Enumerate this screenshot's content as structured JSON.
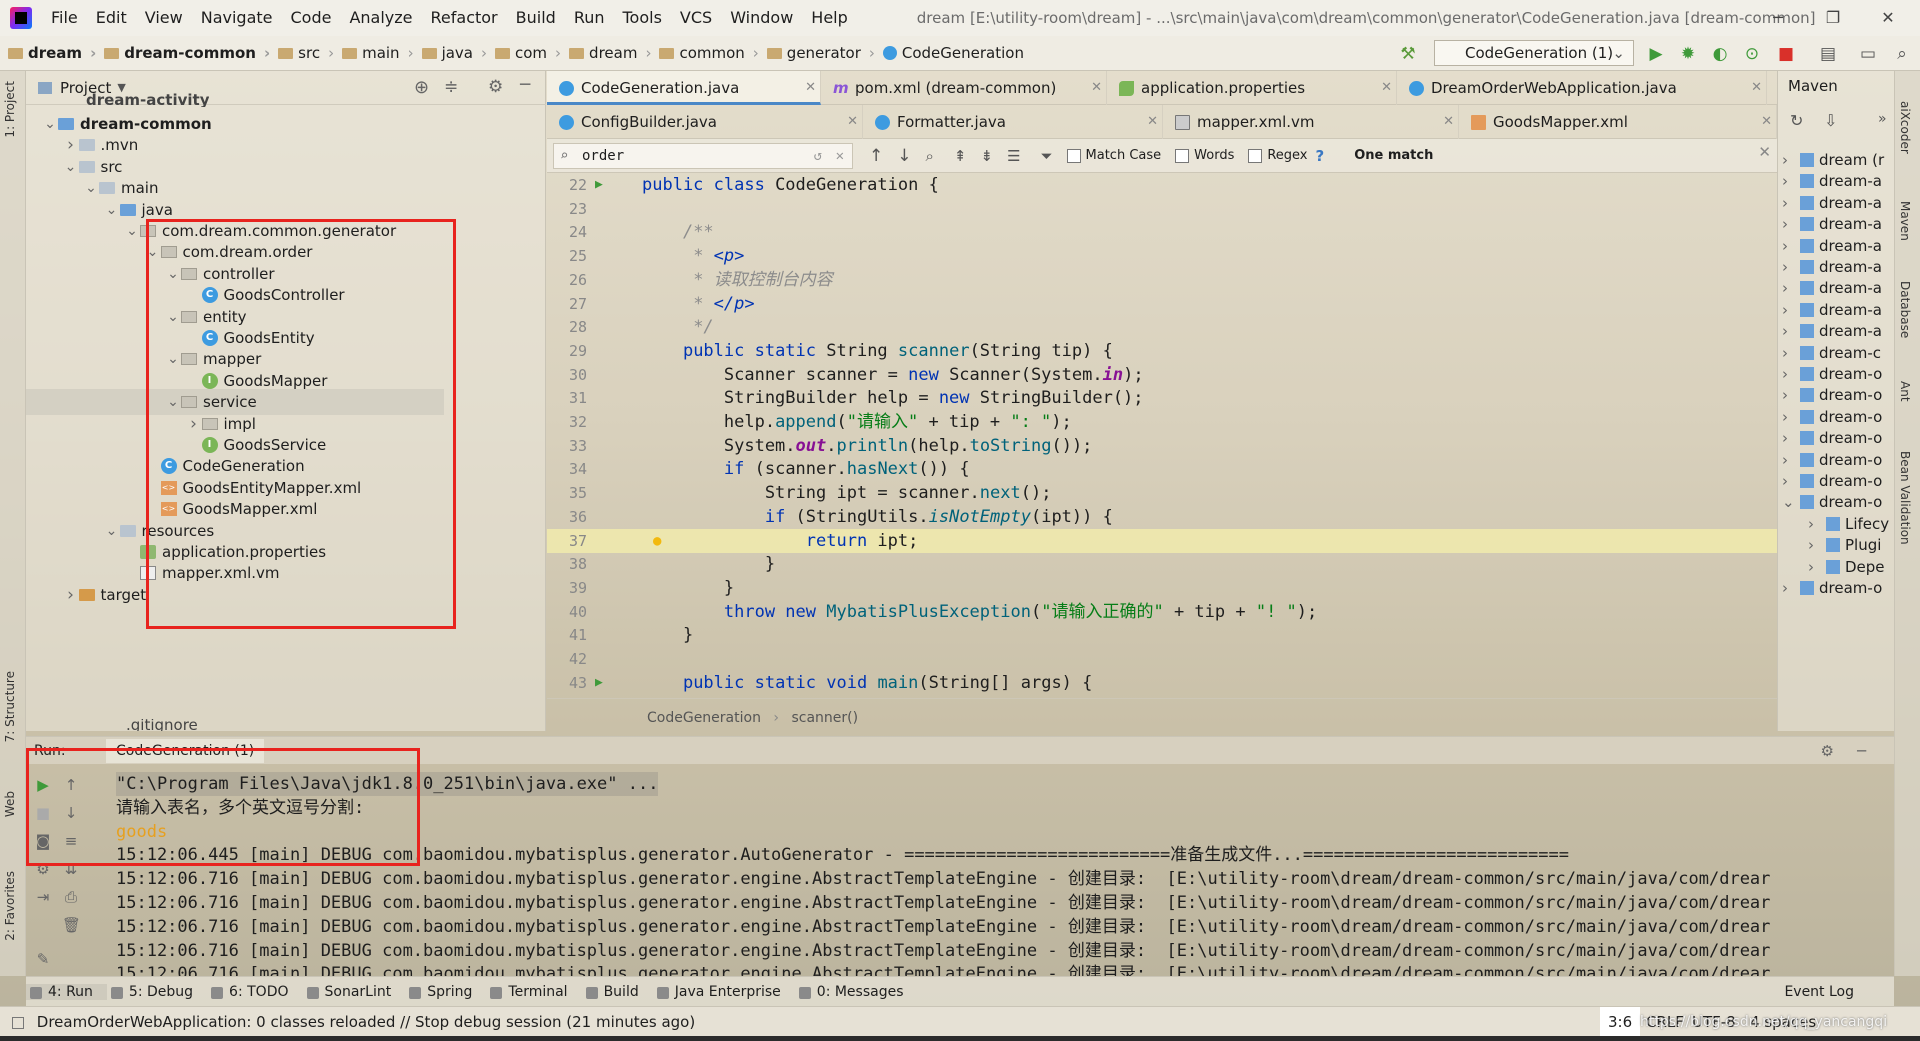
{
  "menu": {
    "items": [
      "File",
      "Edit",
      "View",
      "Navigate",
      "Code",
      "Analyze",
      "Refactor",
      "Build",
      "Run",
      "Tools",
      "VCS",
      "Window",
      "Help"
    ],
    "title": "dream [E:\\utility-room\\dream] - ...\\src\\main\\java\\com\\dream\\common\\generator\\CodeGeneration.java [dream-common]"
  },
  "breadcrumbs": [
    "dream",
    "dream-common",
    "src",
    "main",
    "java",
    "com",
    "dream",
    "common",
    "generator",
    "CodeGeneration"
  ],
  "run_config": "CodeGeneration (1)",
  "project": {
    "header": "Project",
    "truncated_top": "dream-activity",
    "rows": [
      {
        "label": "dream-common",
        "indent": 0,
        "icon": "module",
        "arrow": "down",
        "bold": true
      },
      {
        "label": ".mvn",
        "indent": 1,
        "icon": "folder",
        "arrow": "right"
      },
      {
        "label": "src",
        "indent": 1,
        "icon": "folder",
        "arrow": "down"
      },
      {
        "label": "main",
        "indent": 2,
        "icon": "folder",
        "arrow": "down"
      },
      {
        "label": "java",
        "indent": 3,
        "icon": "folder-blue",
        "arrow": "down"
      },
      {
        "label": "com.dream.common.generator",
        "indent": 4,
        "icon": "package",
        "arrow": "down"
      },
      {
        "label": "com.dream.order",
        "indent": 5,
        "icon": "package",
        "arrow": "down"
      },
      {
        "label": "controller",
        "indent": 6,
        "icon": "package",
        "arrow": "down"
      },
      {
        "label": "GoodsController",
        "indent": 7,
        "icon": "class",
        "arrow": ""
      },
      {
        "label": "entity",
        "indent": 6,
        "icon": "package",
        "arrow": "down"
      },
      {
        "label": "GoodsEntity",
        "indent": 7,
        "icon": "class",
        "arrow": ""
      },
      {
        "label": "mapper",
        "indent": 6,
        "icon": "package",
        "arrow": "down"
      },
      {
        "label": "GoodsMapper",
        "indent": 7,
        "icon": "interface",
        "arrow": ""
      },
      {
        "label": "service",
        "indent": 6,
        "icon": "package",
        "arrow": "down"
      },
      {
        "label": "impl",
        "indent": 7,
        "icon": "package",
        "arrow": "right"
      },
      {
        "label": "GoodsService",
        "indent": 7,
        "icon": "interface",
        "arrow": ""
      },
      {
        "label": "CodeGeneration",
        "indent": 5,
        "icon": "class",
        "arrow": ""
      },
      {
        "label": "GoodsEntityMapper.xml",
        "indent": 5,
        "icon": "xml",
        "arrow": ""
      },
      {
        "label": "GoodsMapper.xml",
        "indent": 5,
        "icon": "xml",
        "arrow": ""
      },
      {
        "label": "resources",
        "indent": 3,
        "icon": "folder",
        "arrow": "down"
      },
      {
        "label": "application.properties",
        "indent": 4,
        "icon": "props",
        "arrow": ""
      },
      {
        "label": "mapper.xml.vm",
        "indent": 4,
        "icon": "vm",
        "arrow": ""
      },
      {
        "label": "target",
        "indent": 1,
        "icon": "folder-orange",
        "arrow": "right"
      }
    ],
    "truncated_bottom": ".gitignore"
  },
  "tabs_row1": [
    {
      "label": "CodeGeneration.java",
      "icon": "class",
      "active": true
    },
    {
      "label": "pom.xml (dream-common)",
      "icon": "m"
    },
    {
      "label": "application.properties",
      "icon": "leaf"
    },
    {
      "label": "DreamOrderWebApplication.java",
      "icon": "class"
    }
  ],
  "tabs_row2": [
    {
      "label": "ConfigBuilder.java",
      "icon": "class"
    },
    {
      "label": "Formatter.java",
      "icon": "class"
    },
    {
      "label": "mapper.xml.vm",
      "icon": "vm"
    },
    {
      "label": "GoodsMapper.xml",
      "icon": "xml"
    }
  ],
  "find": {
    "query": "order",
    "match_case": "Match Case",
    "words": "Words",
    "regex": "Regex",
    "help": "?",
    "result": "One match"
  },
  "code_lines": [
    {
      "n": "22",
      "html": "<span class='kw'>public class</span> CodeGeneration {"
    },
    {
      "n": "23",
      "html": ""
    },
    {
      "n": "24",
      "html": "    <span class='cm'>/**</span>"
    },
    {
      "n": "25",
      "html": "     <span class='cm'>* </span><span class='tag'>&lt;p&gt;</span>"
    },
    {
      "n": "26",
      "html": "     <span class='cm'>* 读取控制台内容</span>"
    },
    {
      "n": "27",
      "html": "     <span class='cm'>* </span><span class='tag'>&lt;/p&gt;</span>"
    },
    {
      "n": "28",
      "html": "     <span class='cm'>*/</span>"
    },
    {
      "n": "29",
      "html": "    <span class='kw'>public static</span> String <span class='fn'>scanner</span>(String tip) {"
    },
    {
      "n": "30",
      "html": "        Scanner scanner = <span class='kw'>new</span> Scanner(System.<span class='fld'>in</span>);"
    },
    {
      "n": "31",
      "html": "        StringBuilder help = <span class='kw'>new</span> StringBuilder();"
    },
    {
      "n": "32",
      "html": "        help.<span class='fn'>append</span>(<span class='str'>\"请输入\"</span> + tip + <span class='str'>\": \"</span>);"
    },
    {
      "n": "33",
      "html": "        System.<span class='fld'>out</span>.<span class='fn'>println</span>(help.<span class='fn'>toString</span>());"
    },
    {
      "n": "34",
      "html": "        <span class='kw'>if</span> (scanner.<span class='fn'>hasNext</span>()) {"
    },
    {
      "n": "35",
      "html": "            String ipt = scanner.<span class='fn'>next</span>();"
    },
    {
      "n": "36",
      "html": "            <span class='kw'>if</span> (StringUtils.<span class='fn' style='font-style:italic'>isNotEmpty</span>(ipt)) {"
    },
    {
      "n": "37",
      "html": "                <span class='kw'>return</span> ipt;",
      "hl": true
    },
    {
      "n": "38",
      "html": "            }"
    },
    {
      "n": "39",
      "html": "        }"
    },
    {
      "n": "40",
      "html": "        <span class='kw'>throw new</span> <span class='fn'>MybatisPlusException</span>(<span class='str'>\"请输入正确的\"</span> + tip + <span class='str'>\"! \"</span>);"
    },
    {
      "n": "41",
      "html": "    }"
    },
    {
      "n": "42",
      "html": ""
    },
    {
      "n": "43",
      "html": "    <span class='kw'>public static void</span> <span class='fn'>main</span>(String[] args) {"
    }
  ],
  "editor_breadcrumb": [
    "CodeGeneration",
    "scanner()"
  ],
  "maven": {
    "title": "Maven",
    "rows": [
      "dream (r",
      "dream-a",
      "dream-a",
      "dream-a",
      "dream-a",
      "dream-a",
      "dream-a",
      "dream-a",
      "dream-a",
      "dream-c",
      "dream-o",
      "dream-o",
      "dream-o",
      "dream-o",
      "dream-o",
      "dream-o",
      "dream-o",
      "Lifecy",
      "Plugi",
      "Depe",
      "dream-o"
    ]
  },
  "run": {
    "label": "Run:",
    "config": "CodeGeneration (1)",
    "lines": [
      {
        "text": "\"C:\\Program Files\\Java\\jdk1.8.0_251\\bin\\java.exe\" ...",
        "kind": "cmd"
      },
      {
        "text": "请输入表名，多个英文逗号分割:",
        "kind": "out"
      },
      {
        "text": "goods",
        "kind": "input"
      },
      {
        "text": "15:12:06.445 [main] DEBUG com.baomidou.mybatisplus.generator.AutoGenerator - ==========================准备生成文件...==========================",
        "kind": "out"
      },
      {
        "text": "15:12:06.716 [main] DEBUG com.baomidou.mybatisplus.generator.engine.AbstractTemplateEngine - 创建目录:  [E:\\utility-room\\dream/dream-common/src/main/java/com/drear",
        "kind": "out"
      },
      {
        "text": "15:12:06.716 [main] DEBUG com.baomidou.mybatisplus.generator.engine.AbstractTemplateEngine - 创建目录:  [E:\\utility-room\\dream/dream-common/src/main/java/com/drear",
        "kind": "out"
      },
      {
        "text": "15:12:06.716 [main] DEBUG com.baomidou.mybatisplus.generator.engine.AbstractTemplateEngine - 创建目录:  [E:\\utility-room\\dream/dream-common/src/main/java/com/drear",
        "kind": "out"
      },
      {
        "text": "15:12:06.716 [main] DEBUG com.baomidou.mybatisplus.generator.engine.AbstractTemplateEngine - 创建目录:  [E:\\utility-room\\dream/dream-common/src/main/java/com/drear",
        "kind": "out"
      },
      {
        "text": "15:12:06.716 [main] DEBUG com.baomidou.mybatisplus.generator.engine.AbstractTemplateEngine - 创建目录:  [E:\\utility-room\\dream/dream-common/src/main/java/com/drear",
        "kind": "out"
      }
    ]
  },
  "bottom_tabs": [
    "4: Run",
    "5: Debug",
    "6: TODO",
    "SonarLint",
    "Spring",
    "Terminal",
    "Build",
    "Java Enterprise",
    "0: Messages"
  ],
  "event_log": "Event Log",
  "status": {
    "message": "DreamOrderWebApplication: 0 classes reloaded // Stop debug session (21 minutes ago)",
    "position": "3:6",
    "line_sep": "CRLF",
    "encoding": "UTF-8",
    "indent": "4 spaces",
    "watermark": "https://blog.csdn.net/qq_yancangqi"
  },
  "left_vtabs": [
    "1: Project",
    "7: Structure",
    "Web",
    "2: Favorites"
  ],
  "right_vtabs": [
    "aiXcoder",
    "Maven",
    "Database",
    "Ant",
    "Bean Validation"
  ],
  "colors": {
    "highlight_box": "#e8231e",
    "accent": "#4a88c7"
  }
}
